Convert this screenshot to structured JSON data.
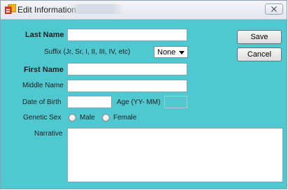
{
  "window": {
    "title": "Edit Information for"
  },
  "form": {
    "last_name": {
      "label": "Last Name",
      "value": ""
    },
    "suffix": {
      "label": "Suffix (Jr, Sr, I, II, III, IV, etc)",
      "selected": "None"
    },
    "first_name": {
      "label": "First Name",
      "value": ""
    },
    "middle_name": {
      "label": "Middle Name",
      "value": ""
    },
    "date_of_birth": {
      "label": "Date of Birth",
      "value": ""
    },
    "age": {
      "label": "Age (YY- MM)",
      "value": ""
    },
    "genetic_sex": {
      "label": "Genetic Sex",
      "options": [
        "Male",
        "Female"
      ]
    },
    "narrative": {
      "label": "Narrative",
      "value": ""
    }
  },
  "buttons": {
    "save": "Save",
    "cancel": "Cancel"
  },
  "icons": {
    "app": "form-icon",
    "close": "close-icon"
  }
}
